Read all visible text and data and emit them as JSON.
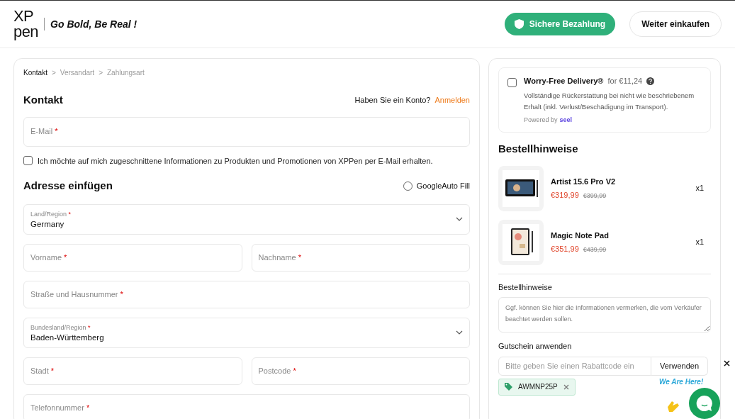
{
  "header": {
    "logo_top": "XP",
    "logo_bottom": "pen",
    "slogan": "Go Bold, Be Real !",
    "secure_button": "Sichere Bezahlung",
    "continue_button": "Weiter einkaufen"
  },
  "breadcrumb": [
    {
      "label": "Kontakt",
      "selected": true
    },
    {
      "label": "Versandart",
      "selected": false
    },
    {
      "label": "Zahlungsart",
      "selected": false
    }
  ],
  "breadcrumb_separator": ">",
  "contact": {
    "title": "Kontakt",
    "account_question": "Haben Sie ein Konto?",
    "login_link": "Anmelden",
    "email": {
      "label": "E-Mail",
      "mark": "*"
    },
    "newsletter": {
      "label": "Ich möchte auf mich zugeschnittene Informationen zu Produkten und Promotionen von XPPen per E-Mail erhalten.",
      "checked": false
    }
  },
  "address": {
    "title": "Adresse einfügen",
    "autofill": {
      "label": "GoogleAuto Fill",
      "checked": false
    },
    "rows": [
      {
        "fields": [
          {
            "kind": "select",
            "label": "Land/Region",
            "mark": "*",
            "value": "Germany"
          }
        ]
      },
      {
        "fields": [
          {
            "kind": "input",
            "label": "Vorname",
            "mark": "*"
          },
          {
            "kind": "input",
            "label": "Nachname",
            "mark": "*"
          }
        ]
      },
      {
        "fields": [
          {
            "kind": "input",
            "label": "Straße und Hausnummer",
            "mark": "*"
          }
        ]
      },
      {
        "fields": [
          {
            "kind": "select",
            "label": "Bundesland/Region",
            "mark": "*",
            "value": "Baden-Württemberg"
          }
        ]
      },
      {
        "fields": [
          {
            "kind": "input",
            "label": "Stadt",
            "mark": "*"
          },
          {
            "kind": "input",
            "label": "Postcode",
            "mark": "*"
          }
        ]
      },
      {
        "fields": [
          {
            "kind": "input",
            "label": "Telefonnummer",
            "mark": "*"
          }
        ]
      }
    ]
  },
  "protection": {
    "title": "Worry-Free Delivery®",
    "price": "for €11,24",
    "checked": false,
    "description": "Vollständige Rückerstattung bei nicht wie beschriebenem Erhalt (inkl. Verlust/Beschädigung im Transport).",
    "powered_by": "Powered by",
    "brand": "seel"
  },
  "order": {
    "title": "Bestellhinweise",
    "items": [
      {
        "kind": "tablet",
        "name": "Artist 15.6 Pro V2",
        "price": "€319,99",
        "old_price": "€399,99",
        "quantity": "x1"
      },
      {
        "kind": "notepad",
        "name": "Magic Note Pad",
        "price": "€351,99",
        "old_price": "€439,99",
        "quantity": "x1"
      }
    ],
    "notes_label": "Bestellhinweise",
    "notes_placeholder": "Ggf. können Sie hier die Informationen vermerken, die vom Verkäufer beachtet werden sollen.",
    "coupon_label": "Gutschein anwenden",
    "coupon_placeholder": "Bitte geben Sie einen Rabattcode ein",
    "apply_button": "Verwenden",
    "applied_code": "AWMNP25P"
  },
  "chat": {
    "badge": "We Are Here!"
  }
}
